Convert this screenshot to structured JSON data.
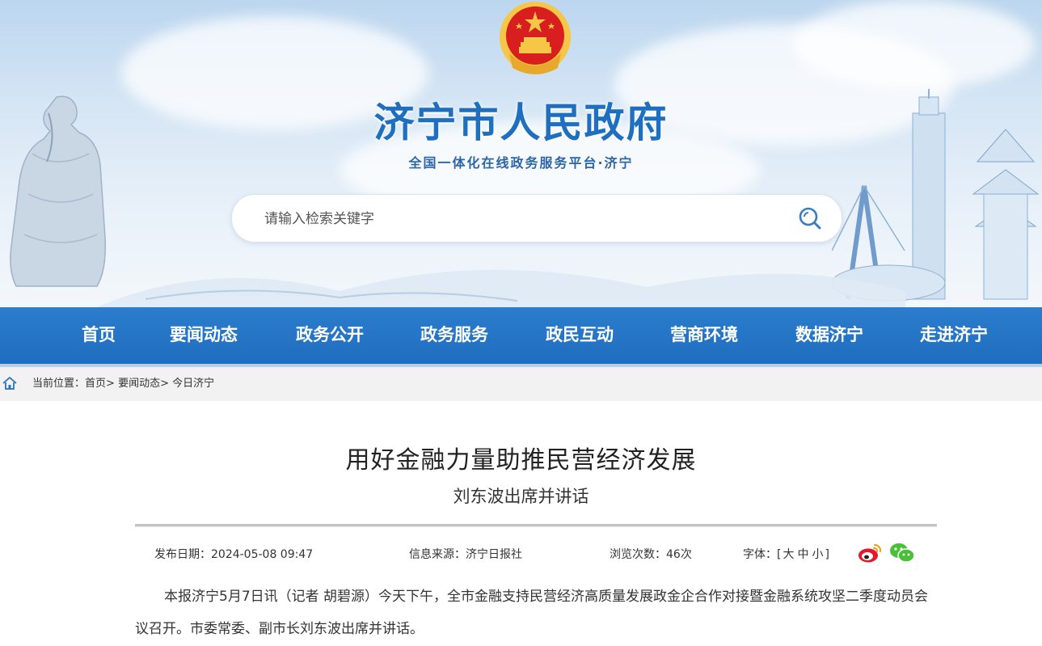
{
  "header": {
    "site_title": "济宁市人民政府",
    "site_subtitle": "全国一体化在线政务服务平台·济宁",
    "search_placeholder": "请输入检索关键字"
  },
  "nav": {
    "items": [
      {
        "label": "首页"
      },
      {
        "label": "要闻动态"
      },
      {
        "label": "政务公开"
      },
      {
        "label": "政务服务"
      },
      {
        "label": "政民互动"
      },
      {
        "label": "营商环境"
      },
      {
        "label": "数据济宁"
      },
      {
        "label": "走进济宁"
      }
    ]
  },
  "breadcrumb": {
    "prefix": "当前位置：",
    "items": [
      "首页",
      "要闻动态",
      "今日济宁"
    ],
    "separator": ">"
  },
  "article": {
    "title": "用好金融力量助推民营经济发展",
    "subtitle": "刘东波出席并讲话",
    "meta": {
      "date": "发布日期：2024-05-08 09:47",
      "source": "信息来源：济宁日报社",
      "views": "浏览次数：46次",
      "font_label": "字体：",
      "font_open": "[",
      "font_large": "大",
      "font_medium": "中",
      "font_small": "小",
      "font_close": "]"
    },
    "paragraph": "本报济宁5月7日讯（记者 胡碧源）今天下午，全市金融支持民营经济高质量发展政金企合作对接暨金融系统攻坚二季度动员会议召开。市委常委、副市长刘东波出席并讲话。"
  },
  "colors": {
    "nav_blue": "#2c7dce",
    "title_blue": "#1f6fc0",
    "emblem_red": "#d81e1e",
    "emblem_gold": "#f6c646",
    "weibo_red": "#e6162d",
    "wechat_green": "#4cbf3a"
  },
  "icons": {
    "search": "search-icon",
    "home": "home-icon",
    "weibo": "weibo-icon",
    "wechat": "wechat-icon",
    "emblem": "national-emblem"
  }
}
